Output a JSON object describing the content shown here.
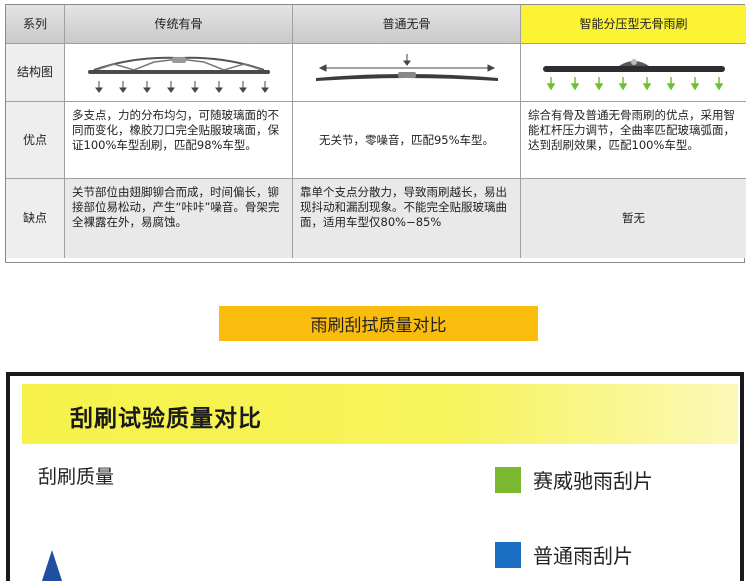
{
  "table": {
    "col_header": "系列",
    "columns": [
      "传统有骨",
      "普通无骨",
      "智能分压型无骨雨刷"
    ],
    "rows": {
      "structure": "结构图",
      "pros": "优点",
      "cons": "缺点"
    },
    "pros": [
      "多支点，力的分布均匀，可随玻璃面的不同而变化，橡胶刀口完全贴服玻璃面，保证100%车型刮刷，匹配98%车型。",
      "无关节，零噪音，匹配95%车型。",
      "综合有骨及普通无骨雨刷的优点，采用智能杠杆压力调节，全曲率匹配玻璃弧面，达到刮刷效果，匹配100%车型。"
    ],
    "cons": [
      "关节部位由翅脚铆合而成，时间偏长，铆接部位易松动，产生“咔咔”噪音。骨架完全裸露在外，易腐蚀。",
      "靠单个支点分散力，导致雨刷越长，易出现抖动和漏刮现象。不能完全贴服玻璃曲面，适用车型仅80%−85%",
      "暂无"
    ]
  },
  "banner": "雨刷刮拭质量对比",
  "panel": {
    "title": "刮刷试验质量对比",
    "quality_label": "刮刷质量",
    "legend": [
      {
        "label": "赛威驰雨刮片",
        "color": "#7cb82f"
      },
      {
        "label": "普通雨刮片",
        "color": "#1a6fc3"
      }
    ]
  },
  "colors": {
    "banner": "#fbbd0d",
    "smart_header": "#fbf334",
    "arrow_green": "#6cc22c",
    "axis_blue": "#1f4fa0"
  }
}
